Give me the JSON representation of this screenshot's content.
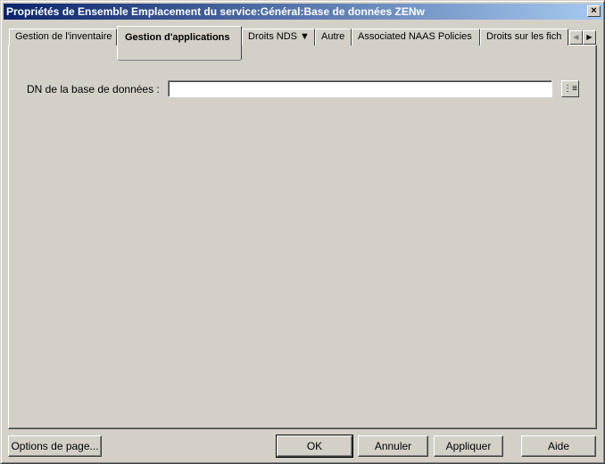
{
  "window": {
    "title": "Propriétés de Ensemble Emplacement du service:Général:Base de données ZENw",
    "close": "×"
  },
  "tabs": [
    {
      "label": "Gestion de l'inventaire"
    },
    {
      "label": "Gestion d'applications",
      "selected": true
    },
    {
      "label": "Droits NDS ▼"
    },
    {
      "label": "Autre"
    },
    {
      "label": "Associated NAAS Policies"
    },
    {
      "label": "Droits sur les fich"
    }
  ],
  "tab_scroll": {
    "left": "◀",
    "right": "▶"
  },
  "form": {
    "dn_label": "DN de la base de données :",
    "dn_value": "",
    "browse": "⋮≡"
  },
  "buttons": {
    "page_options": "Options de page...",
    "ok": "OK",
    "cancel": "Annuler",
    "apply": "Appliquer",
    "help": "Aide"
  }
}
